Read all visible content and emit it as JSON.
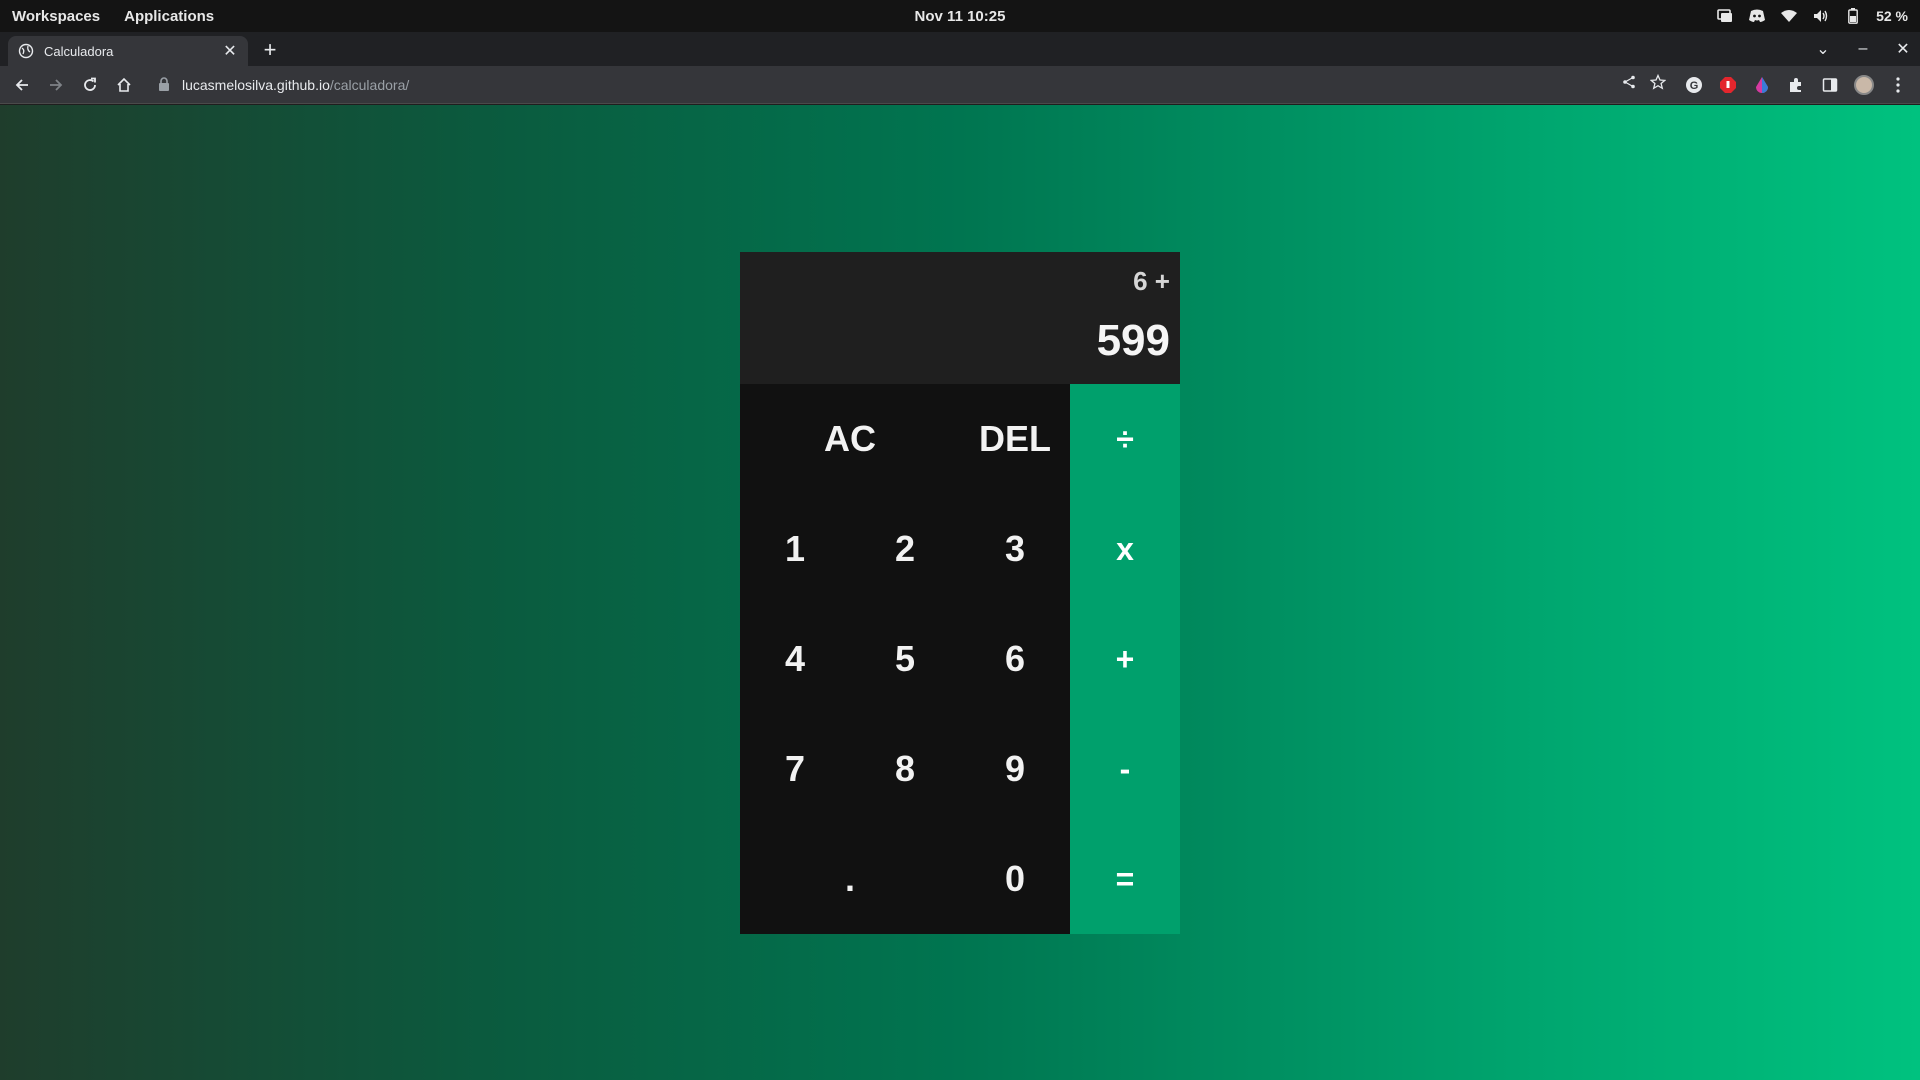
{
  "os": {
    "menu": [
      "Workspaces",
      "Applications"
    ],
    "clock": "Nov 11  10:25",
    "battery": "52 %",
    "tray_icons": [
      "screen-share-icon",
      "discord-icon",
      "wifi-icon",
      "volume-icon",
      "battery-icon"
    ]
  },
  "browser": {
    "tab_title": "Calculadora",
    "url_host": "lucasmelosilva.github.io",
    "url_path": "/calculadora/"
  },
  "calculator": {
    "previous_operand": "6 +",
    "current_operand": "599",
    "keys": {
      "all_clear": "AC",
      "delete": "DEL",
      "divide": "÷",
      "multiply": "x",
      "add": "+",
      "subtract": "-",
      "equals": "=",
      "decimal": ".",
      "d0": "0",
      "d1": "1",
      "d2": "2",
      "d3": "3",
      "d4": "4",
      "d5": "5",
      "d6": "6",
      "d7": "7",
      "d8": "8",
      "d9": "9"
    }
  },
  "colors": {
    "accent": "#00a06c",
    "keypad": "#111111",
    "display": "#1f1f1f"
  }
}
